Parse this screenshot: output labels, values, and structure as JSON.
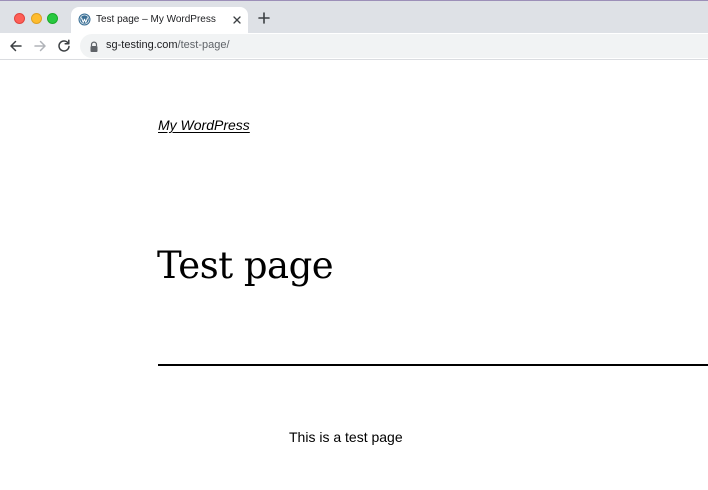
{
  "browser": {
    "tab": {
      "title": "Test page – My WordPress",
      "favicon": "wordpress-icon",
      "close_icon": "close-icon"
    },
    "new_tab_icon": "plus-icon",
    "toolbar": {
      "back_icon": "arrow-left-icon",
      "forward_icon": "arrow-right-icon",
      "reload_icon": "reload-icon",
      "url_host": "sg-testing.com",
      "url_path": "/test-page/",
      "lock_icon": "lock-icon"
    },
    "colors": {
      "tabstrip_bg": "#dee1e6",
      "omnibox_bg": "#f1f3f4",
      "wordpress_blue": "#3a6f95"
    }
  },
  "page": {
    "site_title": "My WordPress",
    "title": "Test page",
    "body": "This is a test page"
  }
}
